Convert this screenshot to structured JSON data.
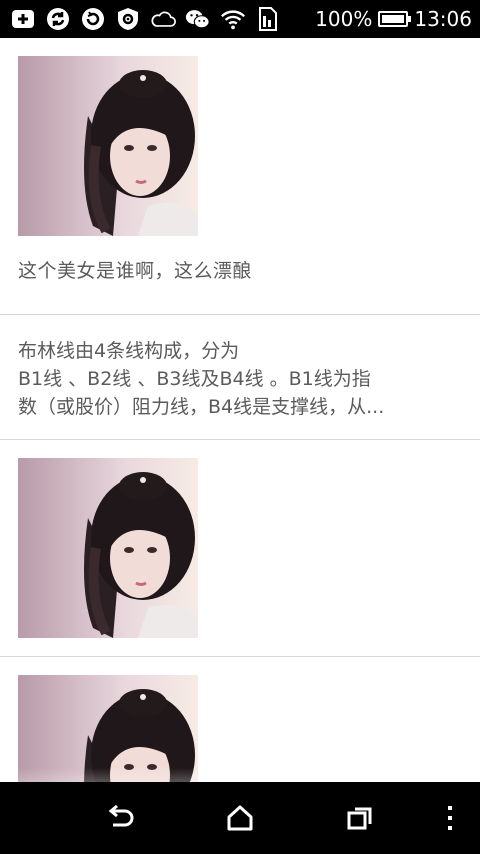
{
  "status_bar": {
    "icons": [
      "add-box-icon",
      "sync-icon",
      "refresh-circle-icon",
      "shield-gear-icon",
      "cloud-icon",
      "wechat-icon",
      "wifi-icon",
      "sim-card-icon"
    ],
    "battery_percent": "100%",
    "battery_level": 1.0,
    "time": "13:06"
  },
  "feed": {
    "items": [
      {
        "type": "image_post",
        "caption": "这个美女是谁啊，这么漂酿"
      },
      {
        "type": "text_post",
        "lines": [
          "布林线由4条线构成，分为",
          "B1线 、B2线 、B3线及B4线 。B1线为指",
          "数（或股价）阻力线，B4线是支撑线，从..."
        ]
      },
      {
        "type": "image_post",
        "caption": ""
      },
      {
        "type": "image_post",
        "caption": ""
      }
    ]
  },
  "nav_bar": {
    "buttons": [
      "back-icon",
      "home-icon",
      "recent-apps-icon",
      "menu-dots-icon"
    ]
  },
  "colors": {
    "status_bar_bg": "#000000",
    "text": "#5b5b5b",
    "divider": "#d6d6d6"
  }
}
